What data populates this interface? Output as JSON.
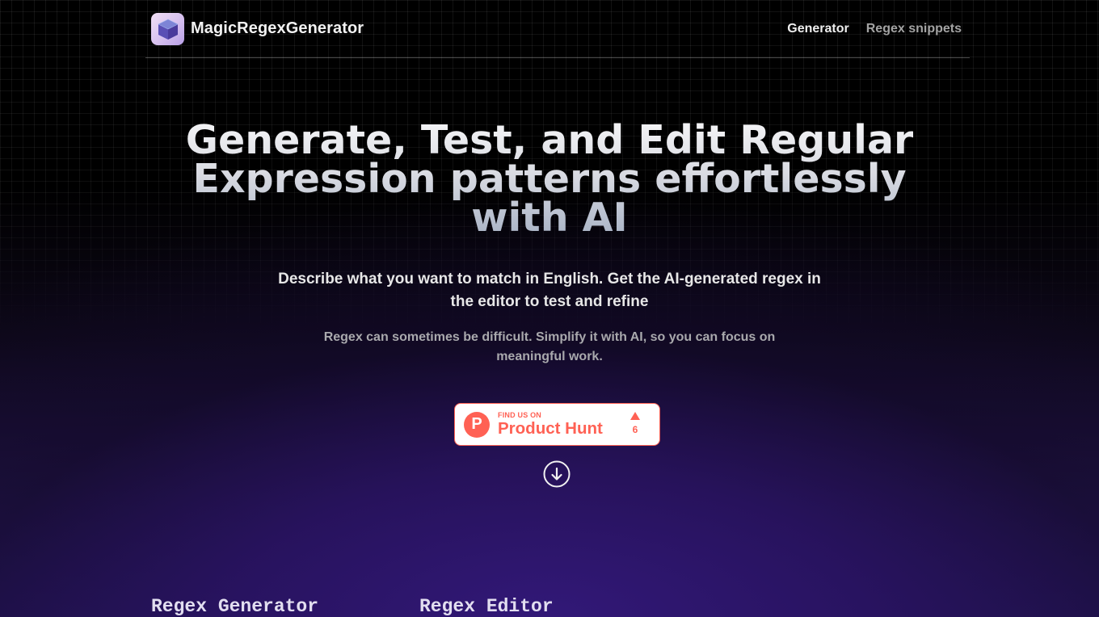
{
  "header": {
    "brand_name": "MagicRegexGenerator",
    "logo_icon": "cube-logo-icon",
    "nav": [
      {
        "label": "Generator",
        "active": true
      },
      {
        "label": "Regex snippets",
        "active": false
      }
    ]
  },
  "hero": {
    "title": "Generate, Test, and Edit Regular Expression patterns effortlessly with AI",
    "lead": "Describe what you want to match in English. Get the AI-generated regex in the editor to test and refine",
    "sub": "Regex can sometimes be difficult. Simplify it with AI, so you can focus on meaningful work."
  },
  "product_hunt": {
    "logo_letter": "P",
    "small_label": "FIND US ON",
    "big_label": "Product Hunt",
    "upvotes": "6",
    "color": "#ff6154"
  },
  "scroll_icon": "arrow-down-circle-icon",
  "sections": {
    "generator_title": "Regex Generator",
    "editor_title": "Regex Editor"
  }
}
